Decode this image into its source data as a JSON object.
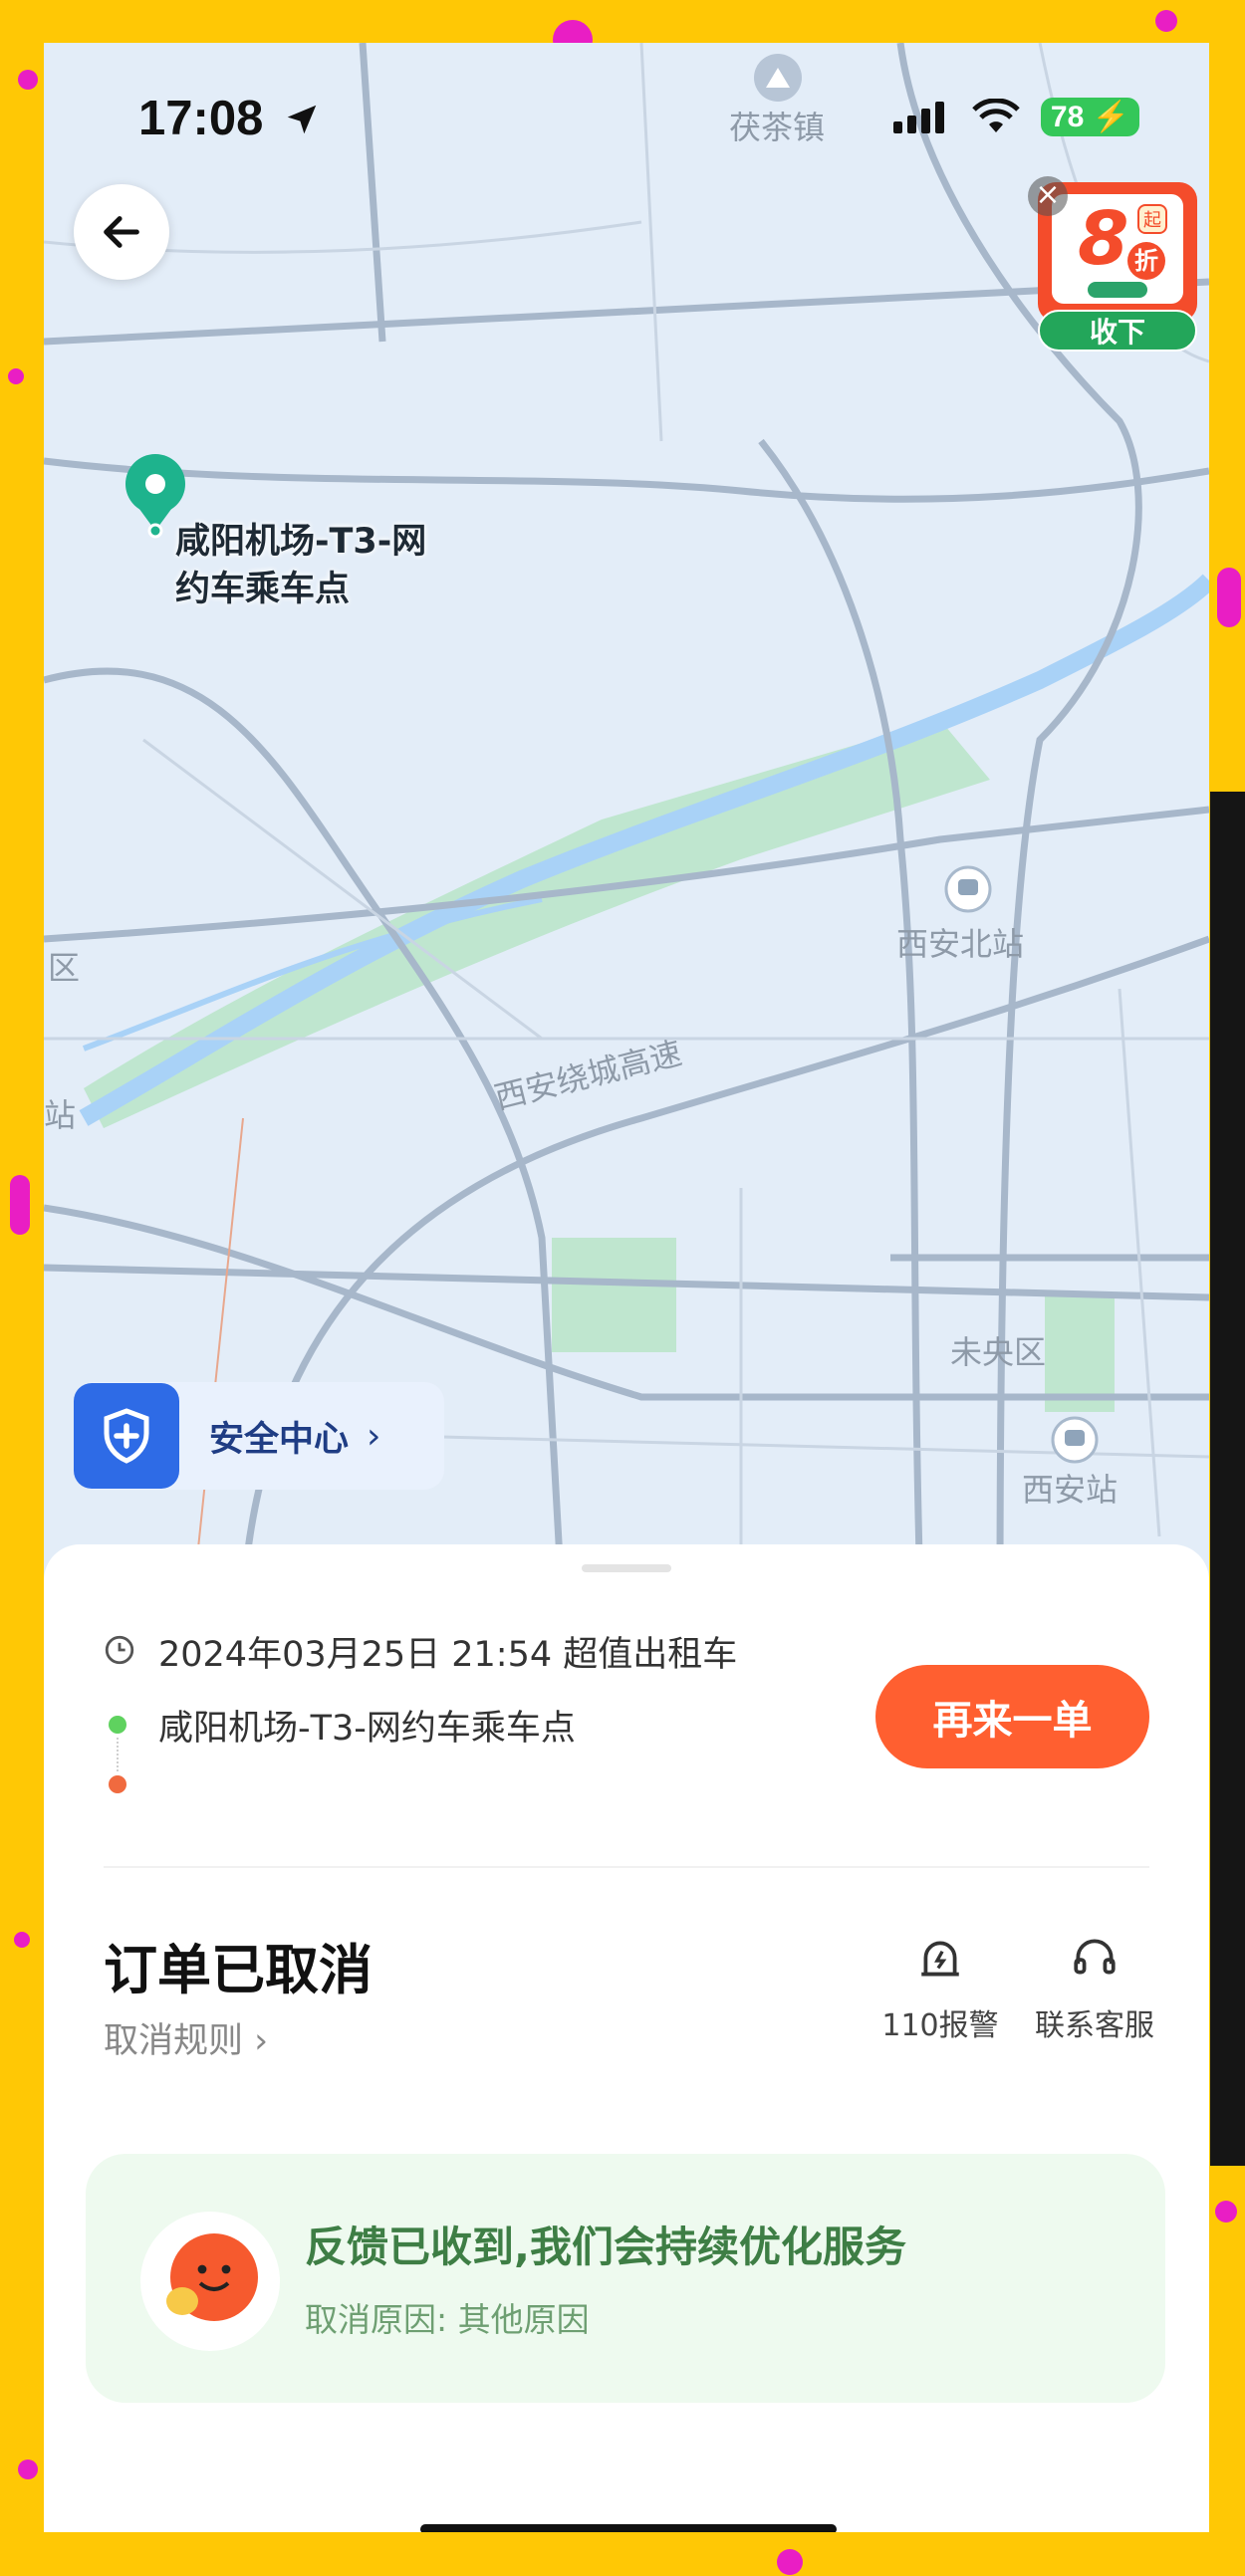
{
  "status_bar": {
    "time": "17:08",
    "battery": "78"
  },
  "map": {
    "pickup_label_line1": "咸阳机场-T3-网",
    "pickup_label_line2": "约车乘车点",
    "labels": {
      "fucha": "茯茶镇",
      "xian_north": "西安北站",
      "ring_expressway": "西安绕城高速",
      "weiyang": "未央区",
      "xian_station": "西安站",
      "district_edge": "区",
      "station_edge": "站"
    }
  },
  "promo": {
    "number": "8",
    "unit": "折",
    "badge": "起",
    "button": "收下"
  },
  "safety_center": {
    "label": "安全中心"
  },
  "trip": {
    "datetime": "2024年03月25日 21:54 超值出租车",
    "pickup": "咸阳机场-T3-网约车乘车点",
    "reorder_button": "再来一单"
  },
  "order": {
    "status": "订单已取消",
    "cancel_rules": "取消规则",
    "police_label": "110报警",
    "service_label": "联系客服"
  },
  "feedback": {
    "title": "反馈已收到,我们会持续优化服务",
    "reason": "取消原因: 其他原因"
  },
  "colors": {
    "accent": "#FF5F30",
    "safety_blue": "#2E6BE6",
    "frame_yellow": "#FFC805"
  }
}
